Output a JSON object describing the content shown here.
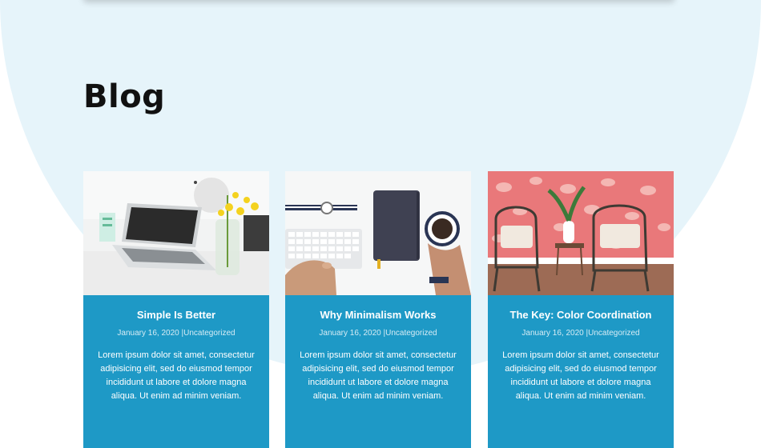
{
  "section": {
    "title": "Blog"
  },
  "posts": [
    {
      "title": "Simple Is Better",
      "date": "January 16, 2020",
      "separator": "|",
      "category": "Uncategorized",
      "excerpt": "Lorem ipsum dolor sit amet, consectetur adipisicing elit, sed do eiusmod tempor incididunt ut labore et dolore magna aliqua. Ut enim ad minim veniam."
    },
    {
      "title": "Why Minimalism Works",
      "date": "January 16, 2020",
      "separator": "|",
      "category": "Uncategorized",
      "excerpt": "Lorem ipsum dolor sit amet, consectetur adipisicing elit, sed do eiusmod tempor incididunt ut labore et dolore magna aliqua. Ut enim ad minim veniam."
    },
    {
      "title": "The Key: Color Coordination",
      "date": "January 16, 2020",
      "separator": "|",
      "category": "Uncategorized",
      "excerpt": "Lorem ipsum dolor sit amet, consectetur adipisicing elit, sed do eiusmod tempor incididunt ut labore et dolore magna aliqua. Ut enim ad minim veniam."
    }
  ],
  "colors": {
    "background_arc": "#e6f4fa",
    "card_background": "#1e99c6",
    "title_text": "#111111",
    "card_text": "#ffffff"
  },
  "icons": [
    "laptop-photo",
    "keyboard-coffee-photo",
    "chairs-wallpaper-photo"
  ]
}
